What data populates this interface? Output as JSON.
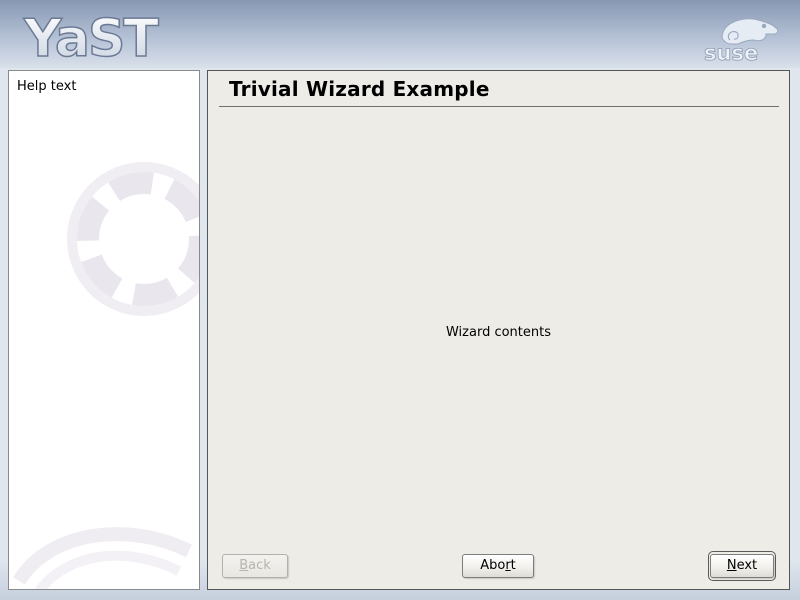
{
  "header": {
    "app_logo_text": "YaST",
    "vendor_logo_text": "suse"
  },
  "help": {
    "text": "Help text"
  },
  "wizard": {
    "title": "Trivial Wizard Example",
    "contents": "Wizard contents"
  },
  "buttons": {
    "back": {
      "pre": "",
      "mnemonic": "B",
      "post": "ack",
      "enabled": false
    },
    "abort": {
      "pre": "Abo",
      "mnemonic": "r",
      "post": "t",
      "enabled": true
    },
    "next": {
      "pre": "",
      "mnemonic": "N",
      "post": "ext",
      "enabled": true,
      "default": true
    }
  },
  "colors": {
    "wizard_background": "#edece7",
    "help_background": "#ffffff",
    "header_top": "#8797b3",
    "header_bottom": "#d9e0ea"
  }
}
